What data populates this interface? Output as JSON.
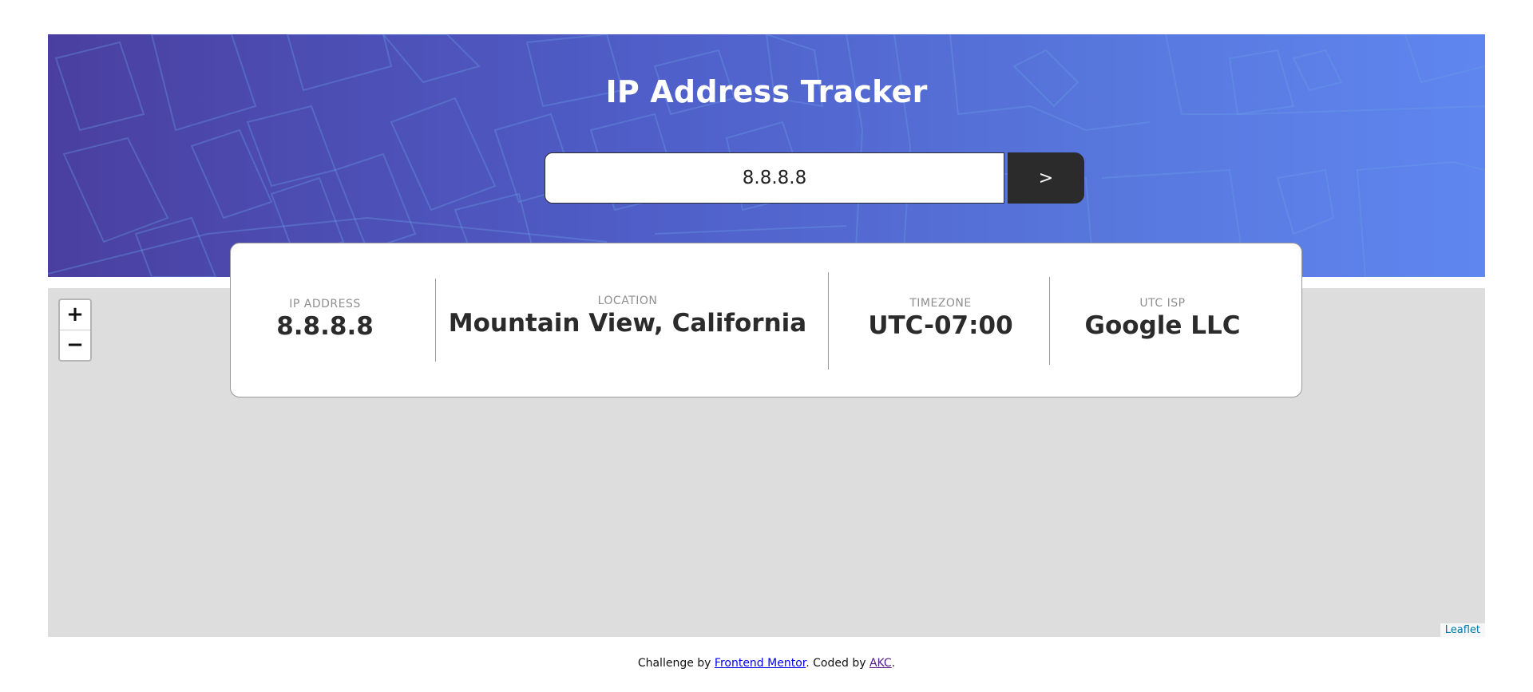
{
  "header": {
    "title": "IP Address Tracker",
    "gradient_colors": [
      "#4a3fa0",
      "#5f86ef"
    ]
  },
  "search": {
    "value": "8.8.8.8",
    "button_label": ">"
  },
  "info": {
    "ip": {
      "label": "IP ADDRESS",
      "value": "8.8.8.8"
    },
    "location": {
      "label": "LOCATION",
      "value": "Mountain View, California"
    },
    "timezone": {
      "label": "TIMEZONE",
      "value": "UTC-07:00"
    },
    "isp": {
      "label": "UTC ISP",
      "value": "Google LLC"
    }
  },
  "map": {
    "zoom_in_label": "+",
    "zoom_out_label": "−",
    "attribution_link": "Leaflet",
    "background_color": "#dddddd"
  },
  "footer": {
    "prefix": "Challenge by ",
    "link1": "Frontend Mentor",
    "middle": ". Coded by ",
    "link2": "AKC",
    "suffix": "."
  }
}
